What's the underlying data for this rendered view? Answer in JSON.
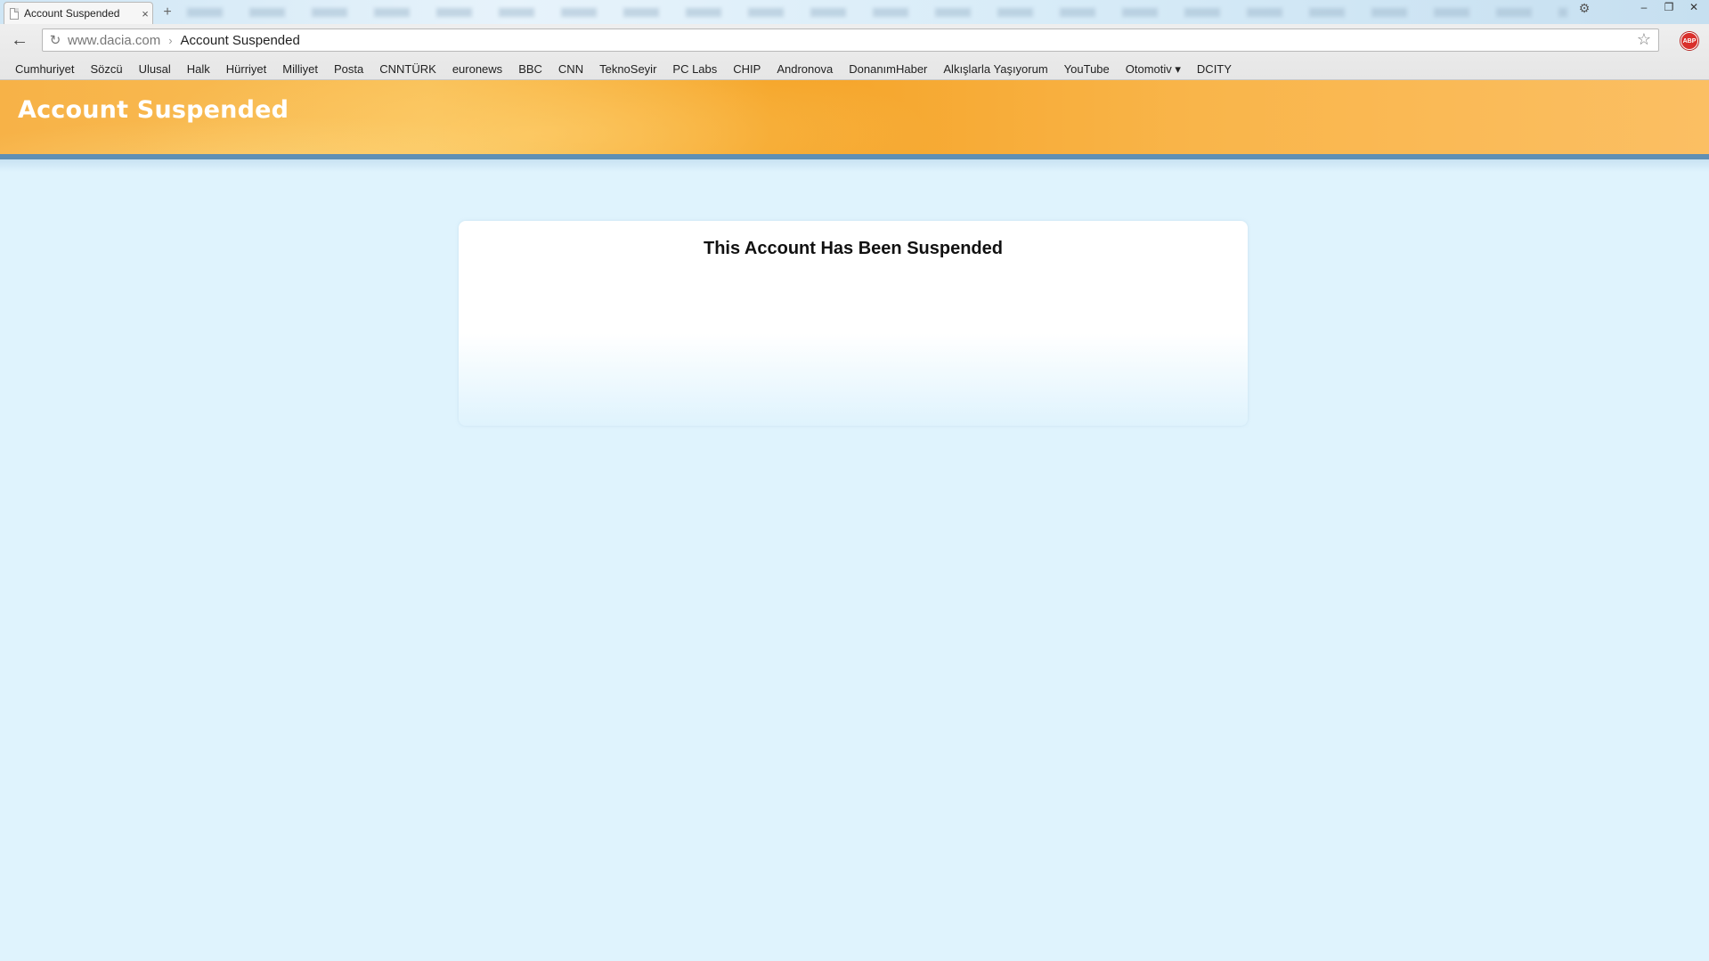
{
  "browser": {
    "tab_title": "Account Suspended",
    "tab_close": "×",
    "new_tab": "+",
    "url_host": "www.dacia.com",
    "url_separator": "›",
    "url_page_title": "Account Suspended",
    "back_icon": "arrow-left-icon",
    "reload_icon": "reload-icon",
    "star_icon": "star-icon",
    "gear_icon": "gear-icon",
    "adblock_label": "ABP",
    "window_controls": [
      "–",
      "❐",
      "✕"
    ]
  },
  "bookmarks": [
    "Cumhuriyet",
    "Sözcü",
    "Ulusal",
    "Halk",
    "Hürriyet",
    "Milliyet",
    "Posta",
    "CNNTÜRK",
    "euronews",
    "BBC",
    "CNN",
    "TeknoSeyir",
    "PC Labs",
    "CHIP",
    "Andronova",
    "DonanımHaber",
    "Alkışlarla Yaşıyorum",
    "YouTube",
    "Otomotiv ▾",
    "DCITY"
  ],
  "page": {
    "header_title": "Account Suspended",
    "message": "This Account Has Been Suspended"
  },
  "colors": {
    "header_orange": "#f7b247",
    "header_bar": "#5f8fb4",
    "page_background": "#dff3fd",
    "box_background": "#ffffff"
  }
}
